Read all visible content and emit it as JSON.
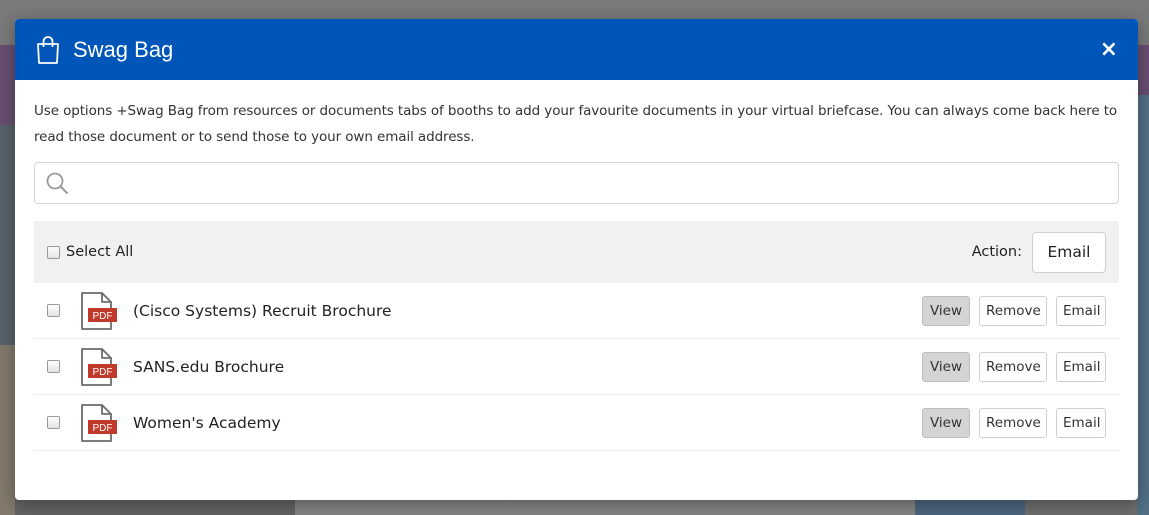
{
  "modal": {
    "title": "Swag Bag",
    "close_glyph": "×",
    "intro": "Use options +Swag Bag from resources or documents tabs of booths to add your favourite documents in your virtual briefcase. You can always come back here to read those document or to send those to your own email address."
  },
  "search": {
    "placeholder": "",
    "value": ""
  },
  "toolbar": {
    "select_all_label": "Select All",
    "action_label": "Action:",
    "email_label": "Email"
  },
  "documents": [
    {
      "title": "(Cisco Systems) Recruit Brochure",
      "type_badge": "PDF"
    },
    {
      "title": "SANS.edu Brochure",
      "type_badge": "PDF"
    },
    {
      "title": "Women's Academy",
      "type_badge": "PDF"
    }
  ],
  "row_buttons": {
    "view": "View",
    "remove": "Remove",
    "email": "Email"
  },
  "icons": {
    "header": "shopping-bag-icon",
    "search": "search-icon",
    "file": "pdf-file-icon",
    "close": "close-icon"
  },
  "colors": {
    "header_bg": "#0056b8",
    "pdf_red": "#c0392b",
    "toolbar_bg": "#f1f1f1"
  }
}
